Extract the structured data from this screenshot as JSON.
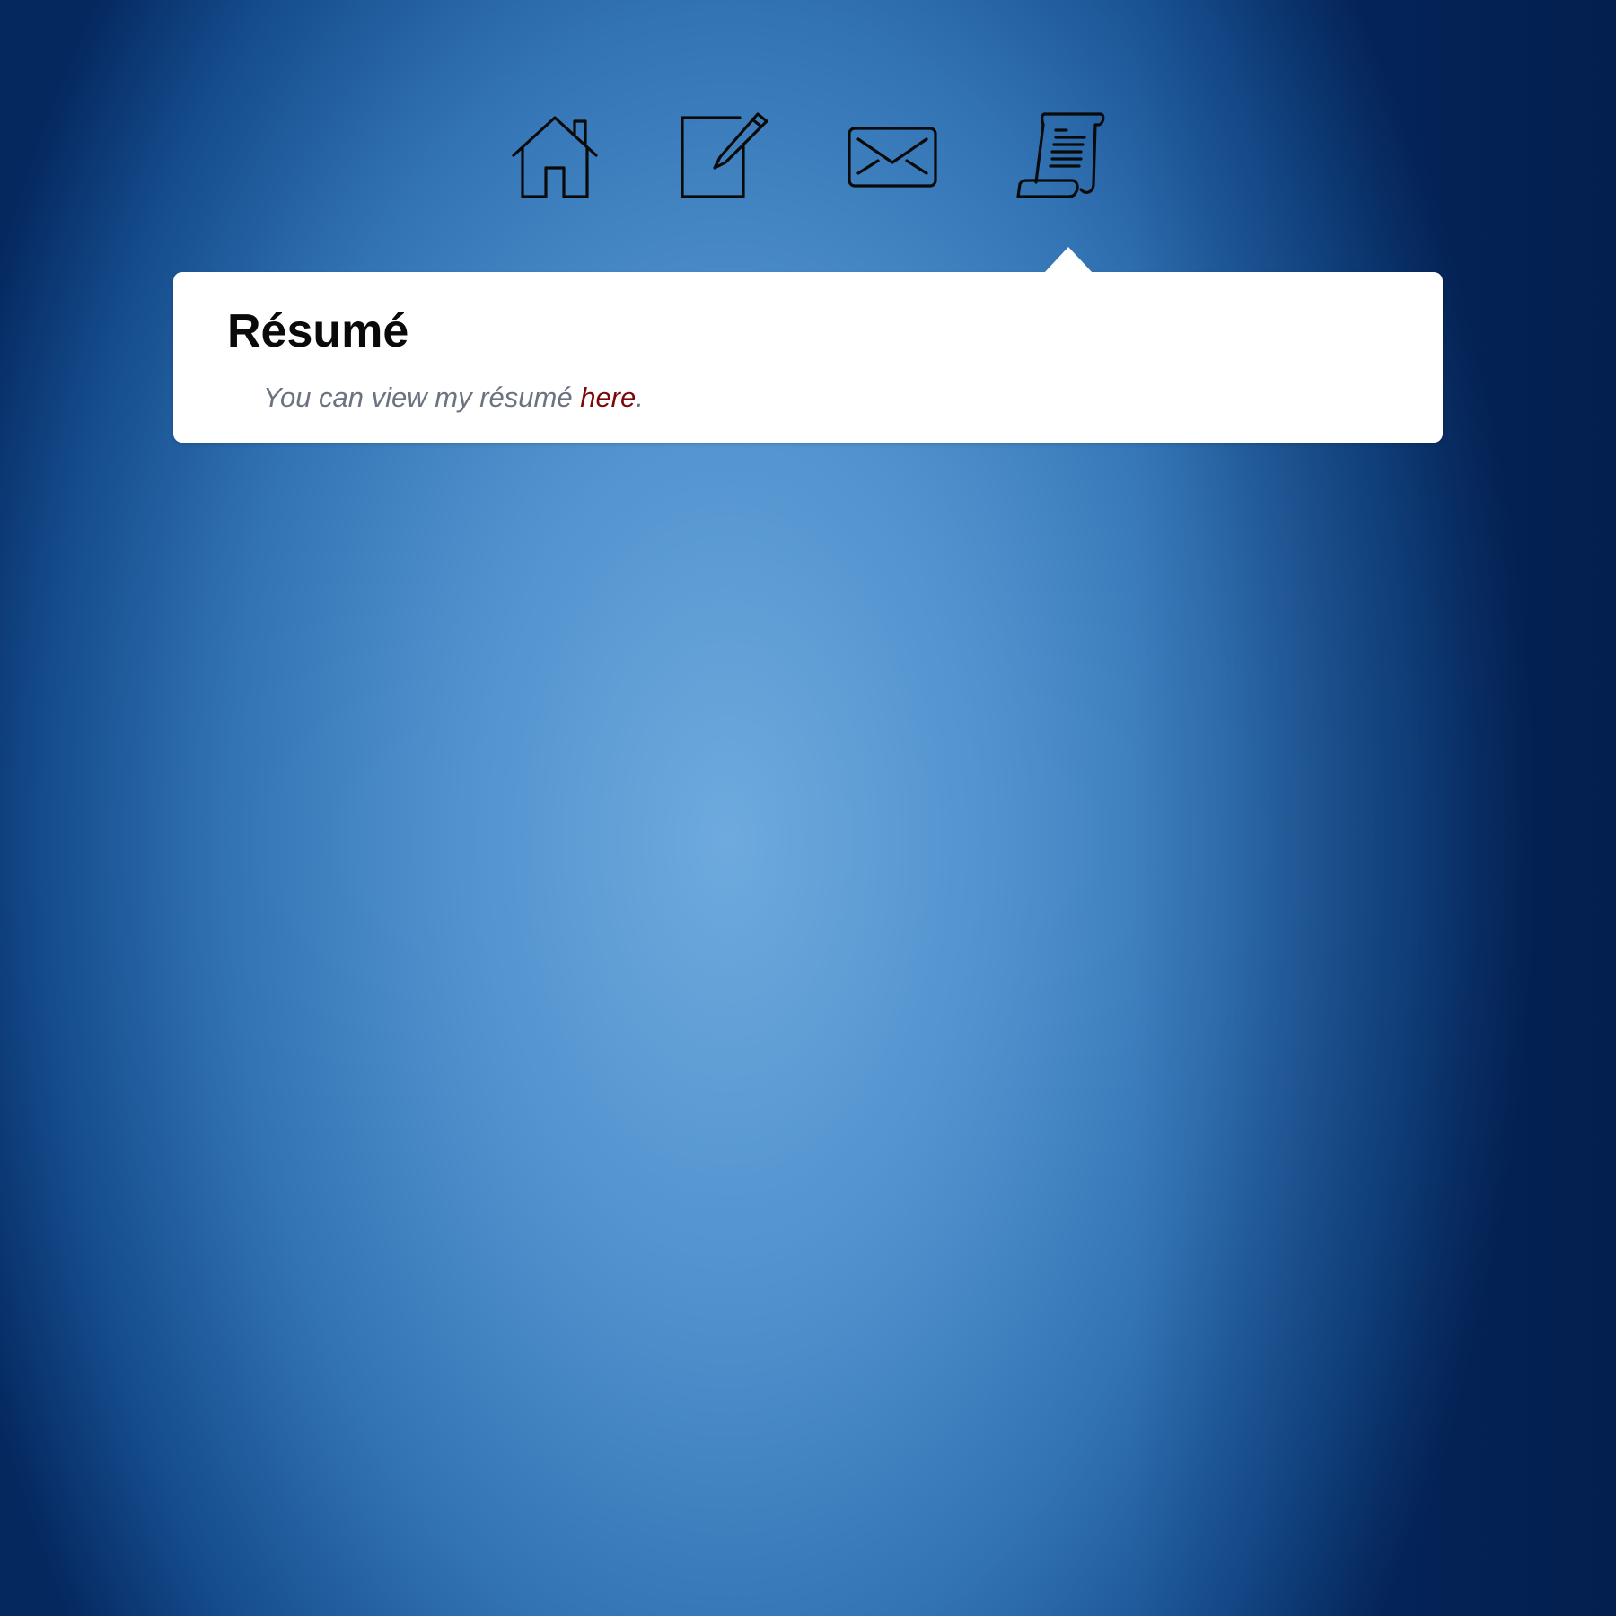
{
  "nav": {
    "items": [
      {
        "icon": "home-icon"
      },
      {
        "icon": "edit-icon"
      },
      {
        "icon": "mail-icon"
      },
      {
        "icon": "resume-scroll-icon",
        "active": true
      }
    ]
  },
  "popover": {
    "title": "Résumé",
    "text_before": "You can view my résumé ",
    "link_text": "here",
    "text_after": "."
  },
  "colors": {
    "background": "#4a8ac8",
    "link": "#7a0a0a",
    "body_text": "#6b7280",
    "title": "#0a0a0a",
    "icon_stroke": "#0a0a0a"
  }
}
